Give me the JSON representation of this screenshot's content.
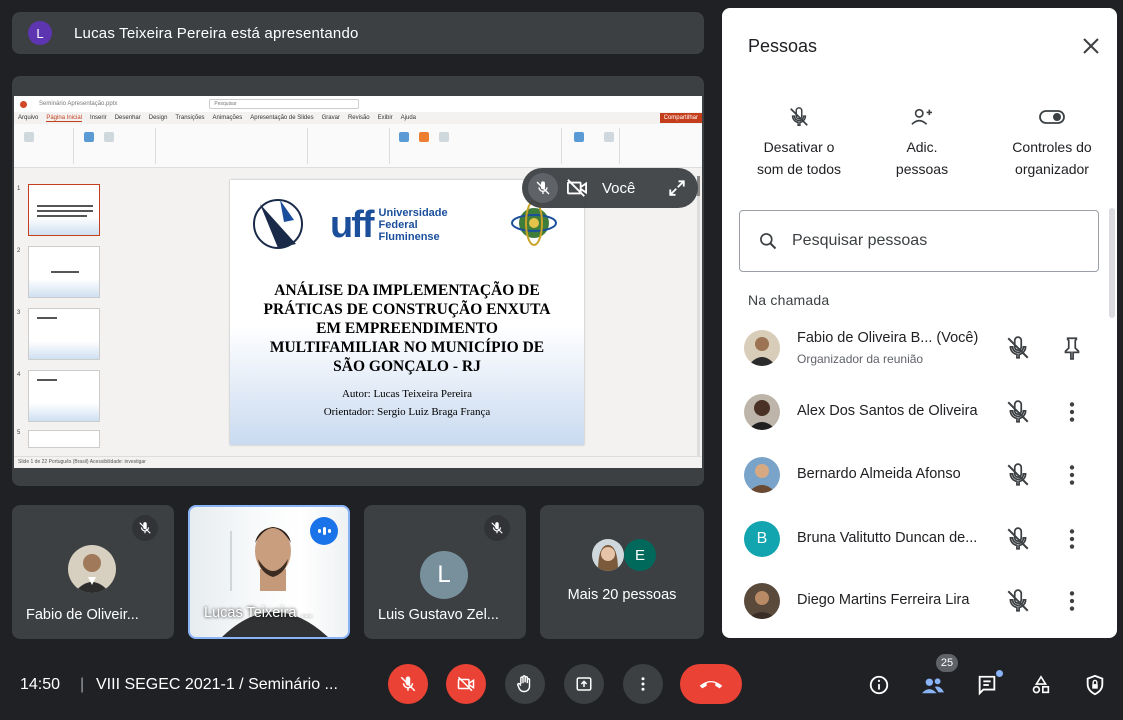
{
  "banner": {
    "avatar_letter": "L",
    "text": "Lucas Teixeira Pereira está apresentando"
  },
  "presentation": {
    "self_label": "Você",
    "app_title": "Seminário Apresentação.pptx",
    "search_placeholder": "Pesquisar",
    "menu": [
      "Arquivo",
      "Página Inicial",
      "Inserir",
      "Desenhar",
      "Design",
      "Transições",
      "Animações",
      "Apresentação de Slides",
      "Gravar",
      "Revisão",
      "Exibir",
      "Ajuda"
    ],
    "active_menu": "Página Inicial",
    "share_label": "Compartilhar",
    "thumb_numbers": [
      "1",
      "2",
      "3",
      "4",
      "5"
    ],
    "status": "Slide 1 de 22   Português (Brasil)   Acessibilidade: investigar",
    "slide": {
      "university_mark": "uff",
      "university_name_1": "Universidade",
      "university_name_2": "Federal",
      "university_name_3": "Fluminense",
      "title_lines": [
        "ANÁLISE DA IMPLEMENTAÇÃO DE",
        "PRÁTICAS DE CONSTRUÇÃO ENXUTA",
        "EM EMPREENDIMENTO",
        "MULTIFAMILIAR NO MUNICÍPIO DE",
        "SÃO GONÇALO - RJ"
      ],
      "author": "Autor: Lucas Teixeira Pereira",
      "advisor": "Orientador: Sergio Luiz Braga França"
    }
  },
  "tiles": [
    {
      "name": "Fabio de Oliveir...",
      "muted": true
    },
    {
      "name": "Lucas Teixeira ...",
      "speaking": true
    },
    {
      "name": "Luis Gustavo Zel...",
      "letter": "L",
      "muted": true
    },
    {
      "name": "Mais 20 pessoas",
      "letter": "E"
    }
  ],
  "panel": {
    "title": "Pessoas",
    "actions": [
      {
        "line1": "Desativar o",
        "line2": "som de todos",
        "icon": "mic-off-icon"
      },
      {
        "line1": "Adic.",
        "line2": "pessoas",
        "icon": "person-add-icon"
      },
      {
        "line1": "Controles do",
        "line2": "organizador",
        "icon": "toggle-icon"
      }
    ],
    "search_placeholder": "Pesquisar pessoas",
    "section_label": "Na chamada",
    "people": [
      {
        "name": "Fabio de Oliveira B...  (Você)",
        "subtitle": "Organizador da reunião"
      },
      {
        "name": "Alex Dos Santos de Oliveira"
      },
      {
        "name": "Bernardo Almeida Afonso"
      },
      {
        "name": "Bruna Valitutto Duncan de...",
        "letter": "B"
      },
      {
        "name": "Diego Martins Ferreira Lira"
      }
    ]
  },
  "bottom": {
    "time": "14:50",
    "separator": "|",
    "meeting_title": "VIII SEGEC 2021-1 / Seminário ...",
    "participants_count": "25"
  },
  "colors": {
    "danger": "#ea4335",
    "accent": "#1a73e8",
    "surface": "#3c4043",
    "background": "#202124"
  }
}
